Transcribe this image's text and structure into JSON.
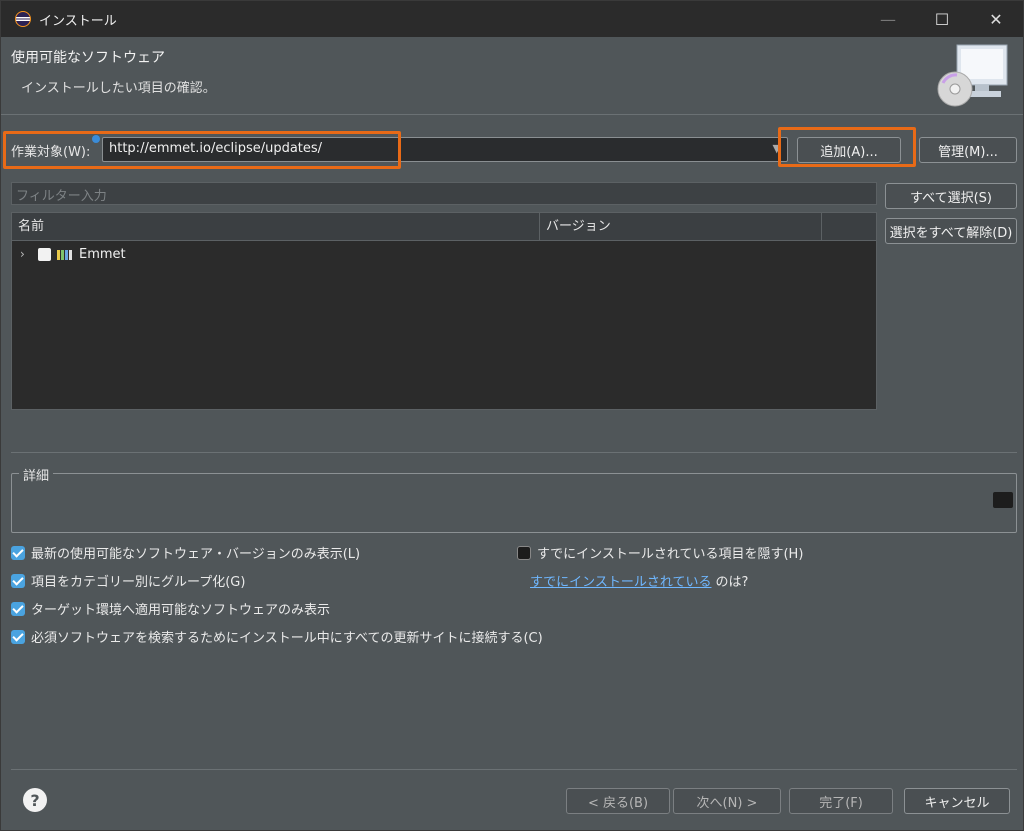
{
  "window": {
    "title": "インストール",
    "controls": {
      "minimize": "—",
      "maximize": "☐",
      "close": "✕"
    }
  },
  "header": {
    "title": "使用可能なソフトウェア",
    "description": "インストールしたい項目の確認。"
  },
  "work_with": {
    "label": "作業対象(W):",
    "url": "http://emmet.io/eclipse/updates/",
    "add_button": "追加(A)...",
    "manage_button": "管理(M)..."
  },
  "filter": {
    "placeholder": "フィルター入力"
  },
  "selection_buttons": {
    "select_all": "すべて選択(S)",
    "deselect_all": "選択をすべて解除(D)"
  },
  "table": {
    "columns": [
      "名前",
      "バージョン"
    ],
    "rows": [
      {
        "name": "Emmet",
        "version": "",
        "checked": false
      }
    ]
  },
  "details": {
    "title": "詳細"
  },
  "options": {
    "show_latest": {
      "label": "最新の使用可能なソフトウェア・バージョンのみ表示(L)",
      "checked": true
    },
    "group_by_category": {
      "label": "項目をカテゴリー別にグループ化(G)",
      "checked": true
    },
    "target_env_only": {
      "label": "ターゲット環境へ適用可能なソフトウェアのみ表示",
      "checked": true
    },
    "contact_all_sites": {
      "label": "必須ソフトウェアを検索するためにインストール中にすべての更新サイトに接続する(C)",
      "checked": true
    },
    "hide_installed": {
      "label": "すでにインストールされている項目を隠す(H)",
      "checked": false
    },
    "already_installed_link": "すでにインストールされている",
    "already_installed_suffix": "のは?"
  },
  "footer": {
    "help": "?",
    "back": "< 戻る(B)",
    "next": "次へ(N) >",
    "finish": "完了(F)",
    "cancel": "キャンセル"
  },
  "colors": {
    "highlight": "#e86a17",
    "checkbox_accent": "#4aa3e0",
    "link": "#6fb7ff"
  }
}
